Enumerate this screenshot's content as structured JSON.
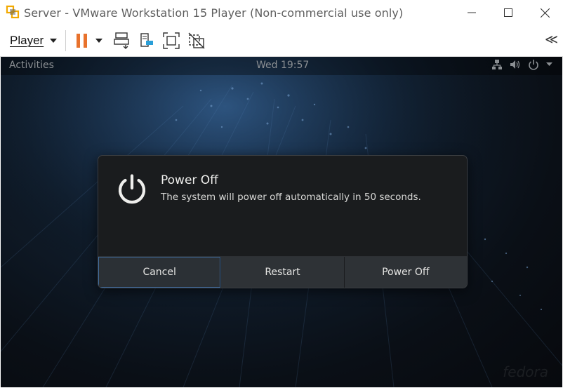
{
  "window": {
    "title": "Server - VMware Workstation 15 Player (Non-commercial use only)",
    "controls": {
      "minimize": "—",
      "maximize": "☐",
      "close": "✕"
    }
  },
  "toolbar": {
    "player_menu_label": "Player",
    "icons": [
      "pause-icon",
      "dropdown-icon",
      "send-ctrl-alt-del-icon",
      "removable-devices-icon",
      "fit-guest-icon",
      "unity-icon"
    ],
    "collapse_label": "≪",
    "accent_color": "#e8722c"
  },
  "guest": {
    "topbar": {
      "activities": "Activities",
      "clock": "Wed 19:57"
    },
    "watermark": "fedora"
  },
  "dialog": {
    "title": "Power Off",
    "message": "The system will power off automatically in 50 seconds.",
    "buttons": [
      {
        "label": "Cancel"
      },
      {
        "label": "Restart"
      },
      {
        "label": "Power Off"
      }
    ]
  }
}
